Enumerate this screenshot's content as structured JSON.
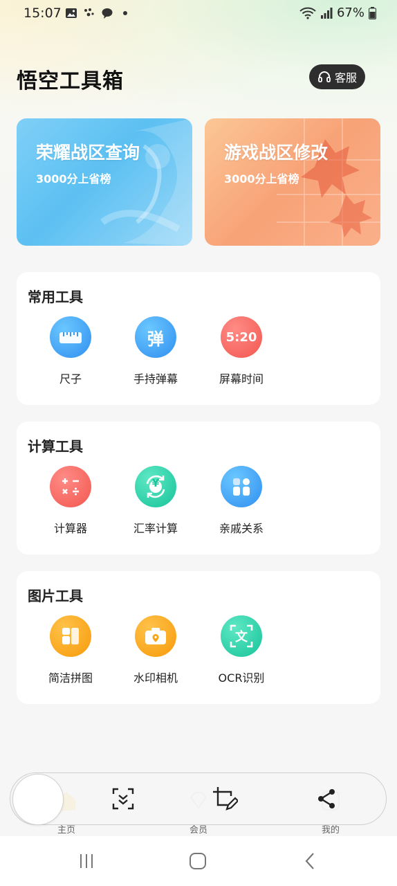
{
  "status_bar": {
    "time": "15:07",
    "battery": "67%"
  },
  "header": {
    "app_title": "悟空工具箱",
    "service_label": "客服"
  },
  "banners": [
    {
      "title": "荣耀战区查询",
      "subtitle": "3000分上省榜",
      "color": "#6cc8f5"
    },
    {
      "title": "游戏战区修改",
      "subtitle": "3000分上省榜",
      "color": "#f9a97d"
    }
  ],
  "sections": {
    "common": {
      "title": "常用工具",
      "tools": [
        {
          "label": "尺子",
          "icon": "ruler-icon"
        },
        {
          "label": "手持弹幕",
          "icon": "danmu-icon",
          "glyph": "弹"
        },
        {
          "label": "屏幕时间",
          "icon": "screen-time-icon",
          "glyph": "5:20"
        }
      ]
    },
    "calc": {
      "title": "计算工具",
      "tools": [
        {
          "label": "计算器",
          "icon": "calculator-icon"
        },
        {
          "label": "汇率计算",
          "icon": "exchange-rate-icon",
          "glyph": "¥"
        },
        {
          "label": "亲戚关系",
          "icon": "relatives-icon"
        }
      ]
    },
    "image": {
      "title": "图片工具",
      "tools": [
        {
          "label": "简洁拼图",
          "icon": "collage-icon"
        },
        {
          "label": "水印相机",
          "icon": "watermark-camera-icon"
        },
        {
          "label": "OCR识别",
          "icon": "ocr-icon",
          "glyph": "文"
        }
      ]
    }
  },
  "bottom_nav": [
    {
      "label": "主页",
      "icon": "home-icon"
    },
    {
      "label": "会员",
      "icon": "diamond-icon"
    },
    {
      "label": "我的",
      "icon": "profile-icon"
    }
  ],
  "floating_toolbar": [
    {
      "icon": "scan-icon"
    },
    {
      "icon": "crop-edit-icon"
    },
    {
      "icon": "share-icon"
    }
  ]
}
